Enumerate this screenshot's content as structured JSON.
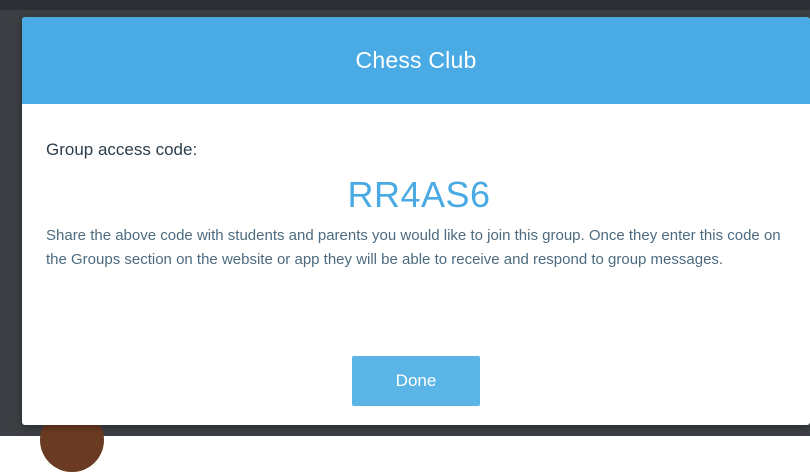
{
  "dialog": {
    "title": "Chess Club",
    "code_label": "Group access code:",
    "access_code": "RR4AS6",
    "description": "Share the above code with students and parents you would like to join this group. Once they enter this code on the Groups section on the website or app they will be able to receive and respond to group messages.",
    "done_label": "Done"
  },
  "colors": {
    "header": "#4aaae3",
    "code": "#4aaae3",
    "button": "#5ab4e6",
    "backdrop": "#3c3f43"
  }
}
